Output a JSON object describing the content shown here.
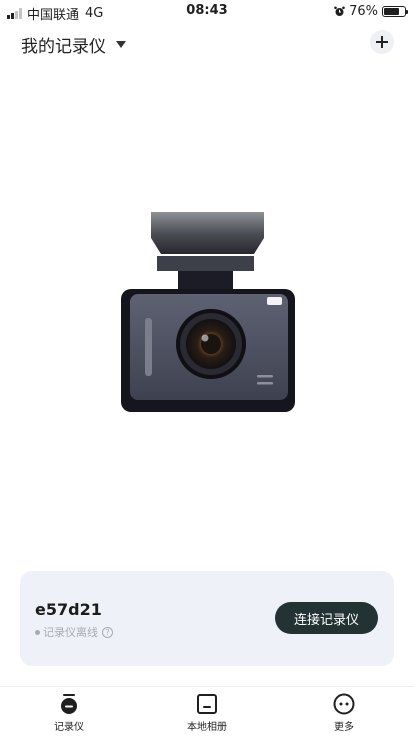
{
  "status_bar": {
    "carrier": "中国联通",
    "network": "4G",
    "time": "08:43",
    "battery": "76%",
    "battery_level": 0.76
  },
  "header": {
    "title": "我的记录仪"
  },
  "device": {
    "name": "e57d21",
    "status": "记录仪离线",
    "connect_label": "连接记录仪"
  },
  "tabs": [
    {
      "label": "记录仪",
      "icon": "dashcam-icon"
    },
    {
      "label": "本地相册",
      "icon": "album-icon"
    },
    {
      "label": "更多",
      "icon": "more-icon"
    }
  ],
  "colors": {
    "primary_button": "#233233",
    "card_background": "#eef1f7",
    "muted_text": "#a6abb6"
  }
}
